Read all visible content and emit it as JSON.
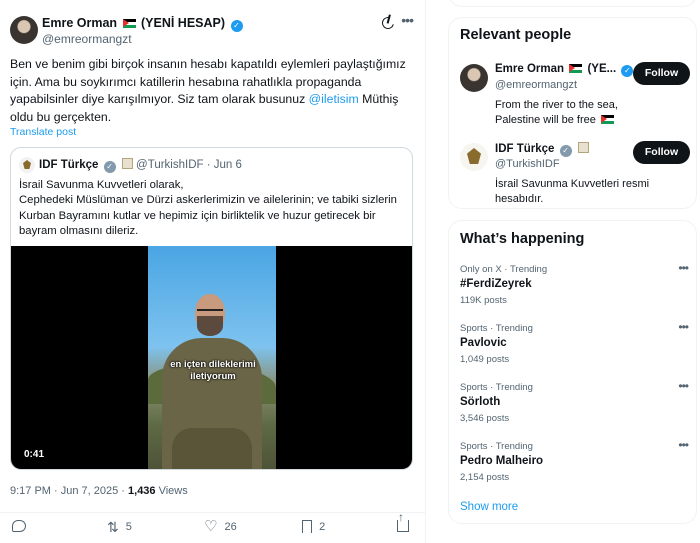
{
  "tweet": {
    "author_name": "Emre Orman",
    "author_suffix": "(YENİ HESAP)",
    "author_handle": "@emreormangzt",
    "text_before": "Ben ve benim gibi birçok insanın hesabı kapatıldı eylemleri paylaştığımız için. Ama bu soykırımcı katillerin hesabına rahatlıkla propaganda yapabilsinler diye karışılmıyor. Siz tam olarak busunuz ",
    "mention": "@iletisim",
    "text_after": " Müthiş oldu bu gerçekten.",
    "translate_label": "Translate post",
    "timestamp": "9:17 PM · Jun 7, 2025 · ",
    "views_count": "1,436",
    "views_label": " Views",
    "actions": {
      "replies": "",
      "reposts": "5",
      "likes": "26",
      "bookmarks": "2"
    }
  },
  "quote": {
    "name": "IDF Türkçe",
    "handle": "@TurkishIDF",
    "date": "· Jun 6",
    "text": "İsrail Savunma Kuvvetleri olarak,\nCephedeki Müslüman ve Dürzi askerlerimizin ve ailelerinin; ve tabiki sizlerin Kurban Bayramını kutlar ve hepimiz için birliktelik ve huzur getirecek bir bayram olmasını dileriz.",
    "video": {
      "subtitle_line1": "en içten dileklerimi",
      "subtitle_line2": "iletiyorum",
      "duration": "0:41"
    }
  },
  "sidebar": {
    "relevant_title": "Relevant people",
    "people": [
      {
        "name": "Emre Orman",
        "name_suffix": "(YE...",
        "handle": "@emreormangzt",
        "bio": "From the river to the sea, Palestine will be free",
        "follow_label": "Follow"
      },
      {
        "name": "IDF Türkçe",
        "handle": "@TurkishIDF",
        "bio": "İsrail Savunma Kuvvetleri resmi hesabıdır.",
        "follow_label": "Follow"
      }
    ],
    "happening_title": "What’s happening",
    "trends": [
      {
        "category": "Only on X · Trending",
        "name": "#FerdiZeyrek",
        "count": "119K posts"
      },
      {
        "category": "Sports · Trending",
        "name": "Pavlovic",
        "count": "1,049 posts"
      },
      {
        "category": "Sports · Trending",
        "name": "Sörloth",
        "count": "3,546 posts"
      },
      {
        "category": "Sports · Trending",
        "name": "Pedro Malheiro",
        "count": "2,154 posts"
      }
    ],
    "show_more": "Show more"
  },
  "colors": {
    "accent": "#1d9bf0",
    "text": "#0f1419",
    "muted": "#536471",
    "border": "#eff3f4"
  },
  "icons": [
    "grok-icon",
    "more-icon",
    "verified-icon",
    "reply-icon",
    "repost-icon",
    "like-icon",
    "bookmark-icon",
    "share-icon"
  ]
}
